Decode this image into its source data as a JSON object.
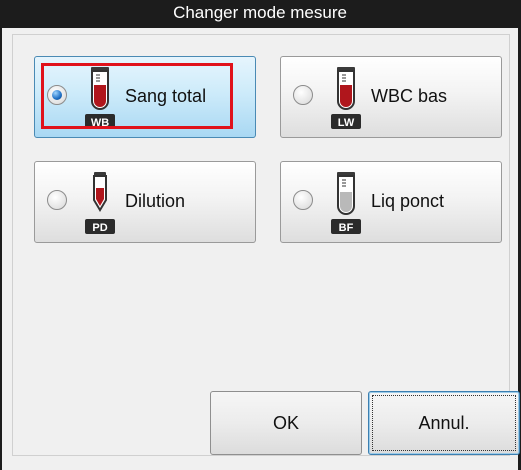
{
  "dialog": {
    "title": "Changer mode mesure"
  },
  "modes": [
    {
      "label": "Sang total",
      "code": "WB",
      "selected": true,
      "icon": "blood-tube-icon"
    },
    {
      "label": "WBC bas",
      "code": "LW",
      "selected": false,
      "icon": "blood-tube-icon"
    },
    {
      "label": "Dilution",
      "code": "PD",
      "selected": false,
      "icon": "diluted-tube-icon"
    },
    {
      "label": "Liq ponct",
      "code": "BF",
      "selected": false,
      "icon": "fluid-tube-icon"
    }
  ],
  "buttons": {
    "ok": "OK",
    "cancel": "Annul."
  },
  "colors": {
    "titlebar": "#1c1c1c",
    "selected_fill": "#cdebfa",
    "highlight_border": "#e0121b",
    "tube_blood": "#b0161c",
    "badge": "#2b2b2b"
  }
}
